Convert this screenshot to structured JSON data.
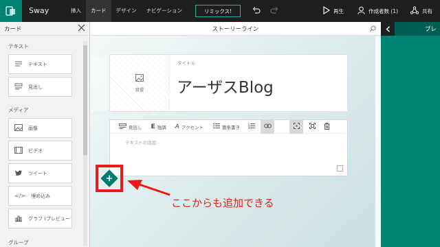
{
  "app": {
    "name": "Sway",
    "logo_icon": "sway-logo-icon"
  },
  "nav": {
    "tabs": [
      {
        "label": "挿入",
        "active": false
      },
      {
        "label": "カード",
        "active": true
      },
      {
        "label": "デザイン",
        "active": false
      },
      {
        "label": "ナビゲーション",
        "active": false
      }
    ],
    "remix_label": "リミックス!",
    "play_label": "再生",
    "authors_label": "作成者数 (1)",
    "share_label": "共有"
  },
  "cards_panel": {
    "title": "カード",
    "sections": [
      {
        "label": "テキスト",
        "items": [
          {
            "label": "テキスト",
            "icon": "text-icon"
          },
          {
            "label": "見出し",
            "icon": "heading-icon"
          }
        ]
      },
      {
        "label": "メディア",
        "items": [
          {
            "label": "画像",
            "icon": "image-icon"
          },
          {
            "label": "ビデオ",
            "icon": "video-icon"
          },
          {
            "label": "ツイート",
            "icon": "twitter-icon"
          },
          {
            "label": "埋め込み",
            "icon": "embed-icon"
          },
          {
            "label": "グラフ (プレビュー",
            "icon": "chart-icon"
          }
        ]
      },
      {
        "label": "グループ",
        "items": []
      }
    ]
  },
  "storyline": {
    "header": "ストーリーライン",
    "title_card": {
      "bg_label": "背景",
      "title_label": "タイトル",
      "title": "アーザスBlog"
    },
    "text_card": {
      "toolbar": {
        "heading": "見出し",
        "emphasis": "強調",
        "accent": "アクセント",
        "bullets": "箇条書き"
      },
      "placeholder": "テキストの追加"
    },
    "annotation": "ここからも追加できる"
  },
  "preview": {
    "title": "プレ"
  },
  "colors": {
    "accent": "#008272",
    "topbar": "#1e1e1e",
    "annotation": "#e81a1a"
  }
}
